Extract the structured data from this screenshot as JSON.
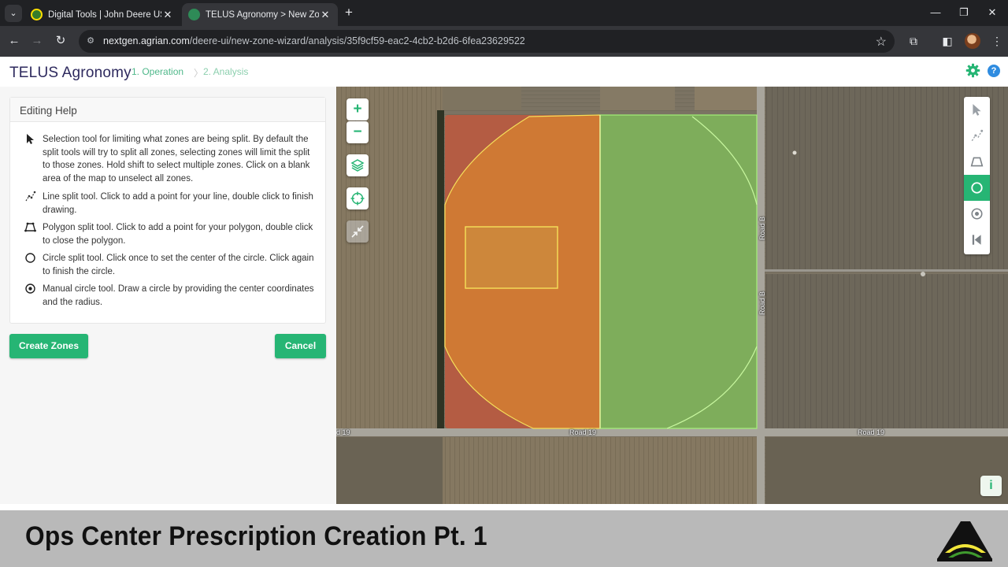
{
  "browser": {
    "tabs": [
      {
        "title": "Digital Tools | John Deere US",
        "active": false
      },
      {
        "title": "TELUS Agronomy > New Zone",
        "active": true
      }
    ],
    "url_host": "nextgen.agrian.com",
    "url_path": "/deere-ui/new-zone-wizard/analysis/35f9cf59-eac2-4cb2-b2d6-6fea23629522"
  },
  "app": {
    "brand": "TELUS Agronomy",
    "steps": [
      "1. Operation",
      "2. Analysis"
    ],
    "step_separator": "〉",
    "help_icon": "?"
  },
  "panel": {
    "heading": "Editing Help",
    "items": [
      {
        "icon": "pointer-icon",
        "text": "Selection tool for limiting what zones are being split. By default the split tools will try to split all zones, selecting zones will limit the split to those zones. Hold shift to select multiple zones. Click on a blank area of the map to unselect all zones."
      },
      {
        "icon": "line-split-icon",
        "text": "Line split tool. Click to add a point for your line, double click to finish drawing."
      },
      {
        "icon": "polygon-split-icon",
        "text": "Polygon split tool. Click to add a point for your polygon, double click to close the polygon."
      },
      {
        "icon": "circle-split-icon",
        "text": "Circle split tool. Click once to set the center of the circle. Click again to finish the circle."
      },
      {
        "icon": "manual-circle-icon",
        "text": "Manual circle tool. Draw a circle by providing the center coordinates and the radius."
      }
    ],
    "create_button": "Create Zones",
    "cancel_button": "Cancel"
  },
  "map": {
    "zoom_in": "+",
    "zoom_out": "−",
    "road_labels": [
      "d 19",
      "Road 19",
      "Road 19",
      "Road B",
      "Road B"
    ],
    "info_button": "i",
    "active_tool": "circle-split-tool",
    "zone_colors": {
      "orange_zone": "#e08a2b",
      "green_zone": "#7ed957",
      "red_zone": "#e0452b",
      "outline_yellow": "#f5e05a"
    }
  },
  "banner": {
    "title": "Ops Center Prescription Creation Pt. 1"
  },
  "colors": {
    "accent": "#26b574",
    "brand_text": "#2e2a5e"
  }
}
